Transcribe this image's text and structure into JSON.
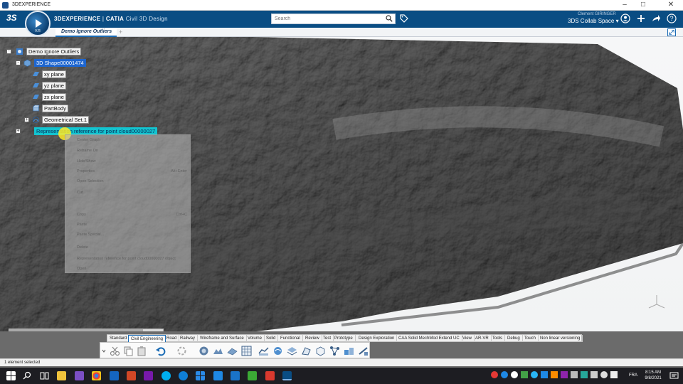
{
  "window": {
    "title": "3DEXPERIENCE"
  },
  "header": {
    "brand_strong": "3DEXPERIENCE",
    "brand_sep": " | ",
    "brand_app": "CATIA",
    "brand_sub": " Civil 3D Design",
    "compass_version": "V.R",
    "search_placeholder": "Search",
    "user_name": "Clement GIRINGER",
    "space_name": "3DS Collab Space"
  },
  "tabs": {
    "active_label": "Demo Ignore Outliers",
    "add_label": "+"
  },
  "tree": {
    "root": "Demo Ignore Outliers",
    "shape": "3D Shape00001474",
    "items": [
      "xy plane",
      "yz plane",
      "zx plane",
      "PartBody",
      "Geometrical Set.1"
    ],
    "representation": "Representation reference for point cloud00000027"
  },
  "context_menu": {
    "items": [
      {
        "label": "Center Graph",
        "shortcut": ""
      },
      {
        "label": "Reframe On",
        "shortcut": ""
      },
      {
        "label": "Hide/Show",
        "shortcut": ""
      },
      {
        "label": "Properties",
        "shortcut": "Alt+Enter"
      },
      {
        "label": "Open Selection",
        "shortcut": ""
      },
      {
        "label": "Cut",
        "shortcut": ""
      },
      {
        "label": "Copy",
        "shortcut": "Ctrl+C"
      },
      {
        "label": "Paste",
        "shortcut": ""
      },
      {
        "label": "Paste Special...",
        "shortcut": ""
      },
      {
        "label": "Delete",
        "shortcut": ""
      },
      {
        "label": "Representation reference for point cloud00000027 object",
        "shortcut": ""
      },
      {
        "label": "Open",
        "shortcut": ""
      }
    ]
  },
  "action_bar": {
    "tabs": [
      "Standard",
      "Civil Engineering",
      "Road",
      "Railway",
      "Wireframe and Surface",
      "Volume",
      "Solid",
      "Functional",
      "Review",
      "Test",
      "Prototype",
      "Design Exploration",
      "CAA Solid MechMod Extend UC",
      "View",
      "AR-VR",
      "Tools",
      "Debug",
      "Touch",
      "Non linear versioning"
    ],
    "active_tab": "Civil Engineering"
  },
  "status": {
    "text": "1 element selected"
  },
  "taskbar": {
    "language": "FRA",
    "time": "8:15 AM",
    "date": "9/8/2021"
  },
  "colors": {
    "header_bg": "#0a4d83",
    "selection_blue": "#1e66d0",
    "selection_cyan": "#13c4d0",
    "accent": "#1a6bb5"
  }
}
